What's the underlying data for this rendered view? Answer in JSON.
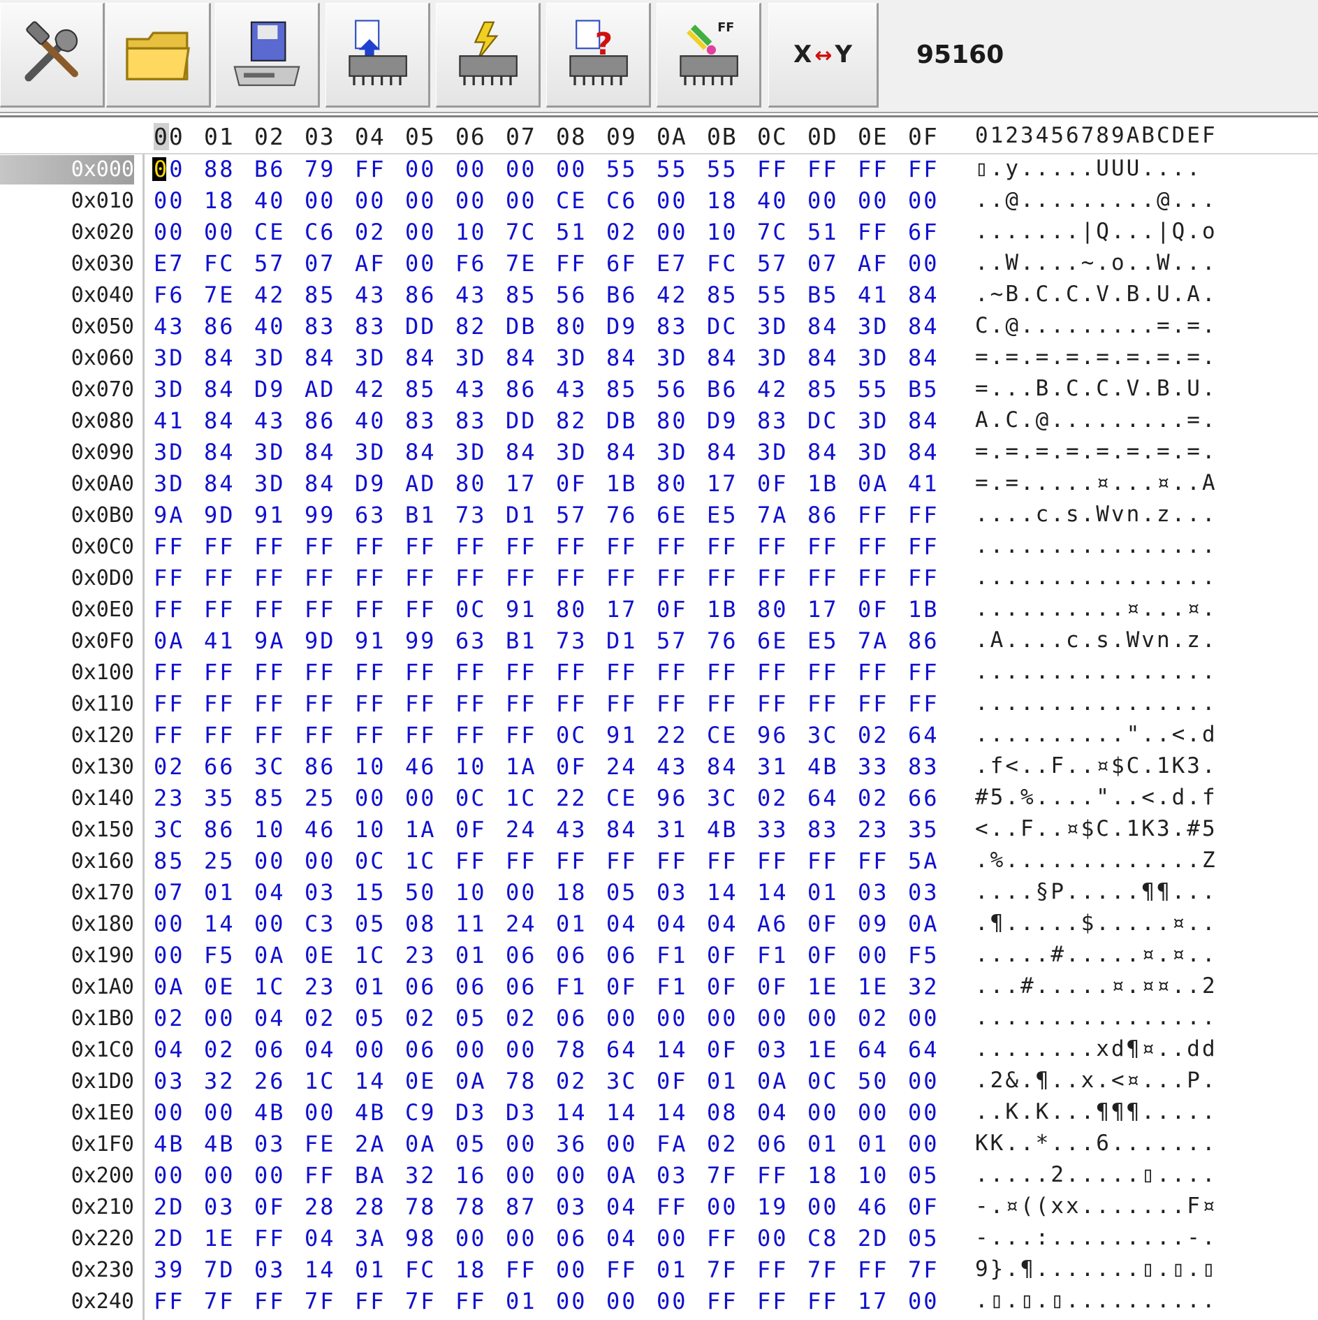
{
  "toolbar": {
    "buttons": [
      {
        "name": "settings-tools-icon"
      },
      {
        "name": "open-folder-icon"
      },
      {
        "name": "save-to-disk-icon"
      },
      {
        "name": "read-chip-icon"
      },
      {
        "name": "write-chip-icon"
      },
      {
        "name": "verify-chip-icon"
      },
      {
        "name": "erase-chip-icon"
      }
    ],
    "swap_x": "X",
    "swap_arrow": "↔",
    "swap_y": "Y",
    "counter": "95160"
  },
  "colors": {
    "hex_text": "#1010d0",
    "cursor_bg": "#000000",
    "cursor_fg": "#ffd800"
  },
  "header": {
    "columns": [
      "00",
      "01",
      "02",
      "03",
      "04",
      "05",
      "06",
      "07",
      "08",
      "09",
      "0A",
      "0B",
      "0C",
      "0D",
      "0E",
      "0F"
    ],
    "ascii_header": "0123456789ABCDEF"
  },
  "rows": [
    {
      "addr": "0x000",
      "bytes": [
        "00",
        "88",
        "B6",
        "79",
        "FF",
        "00",
        "00",
        "00",
        "00",
        "55",
        "55",
        "55",
        "FF",
        "FF",
        "FF",
        "FF"
      ],
      "ascii": "▯.y.....UUU...."
    },
    {
      "addr": "0x010",
      "bytes": [
        "00",
        "18",
        "40",
        "00",
        "00",
        "00",
        "00",
        "00",
        "CE",
        "C6",
        "00",
        "18",
        "40",
        "00",
        "00",
        "00"
      ],
      "ascii": "..@.........@..."
    },
    {
      "addr": "0x020",
      "bytes": [
        "00",
        "00",
        "CE",
        "C6",
        "02",
        "00",
        "10",
        "7C",
        "51",
        "02",
        "00",
        "10",
        "7C",
        "51",
        "FF",
        "6F"
      ],
      "ascii": ".......|Q...|Q.o"
    },
    {
      "addr": "0x030",
      "bytes": [
        "E7",
        "FC",
        "57",
        "07",
        "AF",
        "00",
        "F6",
        "7E",
        "FF",
        "6F",
        "E7",
        "FC",
        "57",
        "07",
        "AF",
        "00"
      ],
      "ascii": "..W....~.o..W..."
    },
    {
      "addr": "0x040",
      "bytes": [
        "F6",
        "7E",
        "42",
        "85",
        "43",
        "86",
        "43",
        "85",
        "56",
        "B6",
        "42",
        "85",
        "55",
        "B5",
        "41",
        "84"
      ],
      "ascii": ".~B.C.C.V.B.U.A."
    },
    {
      "addr": "0x050",
      "bytes": [
        "43",
        "86",
        "40",
        "83",
        "83",
        "DD",
        "82",
        "DB",
        "80",
        "D9",
        "83",
        "DC",
        "3D",
        "84",
        "3D",
        "84"
      ],
      "ascii": "C.@.........=.=."
    },
    {
      "addr": "0x060",
      "bytes": [
        "3D",
        "84",
        "3D",
        "84",
        "3D",
        "84",
        "3D",
        "84",
        "3D",
        "84",
        "3D",
        "84",
        "3D",
        "84",
        "3D",
        "84"
      ],
      "ascii": "=.=.=.=.=.=.=.=."
    },
    {
      "addr": "0x070",
      "bytes": [
        "3D",
        "84",
        "D9",
        "AD",
        "42",
        "85",
        "43",
        "86",
        "43",
        "85",
        "56",
        "B6",
        "42",
        "85",
        "55",
        "B5"
      ],
      "ascii": "=...B.C.C.V.B.U."
    },
    {
      "addr": "0x080",
      "bytes": [
        "41",
        "84",
        "43",
        "86",
        "40",
        "83",
        "83",
        "DD",
        "82",
        "DB",
        "80",
        "D9",
        "83",
        "DC",
        "3D",
        "84"
      ],
      "ascii": "A.C.@.........=."
    },
    {
      "addr": "0x090",
      "bytes": [
        "3D",
        "84",
        "3D",
        "84",
        "3D",
        "84",
        "3D",
        "84",
        "3D",
        "84",
        "3D",
        "84",
        "3D",
        "84",
        "3D",
        "84"
      ],
      "ascii": "=.=.=.=.=.=.=.=."
    },
    {
      "addr": "0x0A0",
      "bytes": [
        "3D",
        "84",
        "3D",
        "84",
        "D9",
        "AD",
        "80",
        "17",
        "0F",
        "1B",
        "80",
        "17",
        "0F",
        "1B",
        "0A",
        "41"
      ],
      "ascii": "=.=.....¤...¤..A"
    },
    {
      "addr": "0x0B0",
      "bytes": [
        "9A",
        "9D",
        "91",
        "99",
        "63",
        "B1",
        "73",
        "D1",
        "57",
        "76",
        "6E",
        "E5",
        "7A",
        "86",
        "FF",
        "FF"
      ],
      "ascii": "....c.s.Wvn.z..."
    },
    {
      "addr": "0x0C0",
      "bytes": [
        "FF",
        "FF",
        "FF",
        "FF",
        "FF",
        "FF",
        "FF",
        "FF",
        "FF",
        "FF",
        "FF",
        "FF",
        "FF",
        "FF",
        "FF",
        "FF"
      ],
      "ascii": "................"
    },
    {
      "addr": "0x0D0",
      "bytes": [
        "FF",
        "FF",
        "FF",
        "FF",
        "FF",
        "FF",
        "FF",
        "FF",
        "FF",
        "FF",
        "FF",
        "FF",
        "FF",
        "FF",
        "FF",
        "FF"
      ],
      "ascii": "................"
    },
    {
      "addr": "0x0E0",
      "bytes": [
        "FF",
        "FF",
        "FF",
        "FF",
        "FF",
        "FF",
        "0C",
        "91",
        "80",
        "17",
        "0F",
        "1B",
        "80",
        "17",
        "0F",
        "1B"
      ],
      "ascii": "..........¤...¤."
    },
    {
      "addr": "0x0F0",
      "bytes": [
        "0A",
        "41",
        "9A",
        "9D",
        "91",
        "99",
        "63",
        "B1",
        "73",
        "D1",
        "57",
        "76",
        "6E",
        "E5",
        "7A",
        "86"
      ],
      "ascii": ".A....c.s.Wvn.z."
    },
    {
      "addr": "0x100",
      "bytes": [
        "FF",
        "FF",
        "FF",
        "FF",
        "FF",
        "FF",
        "FF",
        "FF",
        "FF",
        "FF",
        "FF",
        "FF",
        "FF",
        "FF",
        "FF",
        "FF"
      ],
      "ascii": "................"
    },
    {
      "addr": "0x110",
      "bytes": [
        "FF",
        "FF",
        "FF",
        "FF",
        "FF",
        "FF",
        "FF",
        "FF",
        "FF",
        "FF",
        "FF",
        "FF",
        "FF",
        "FF",
        "FF",
        "FF"
      ],
      "ascii": "................"
    },
    {
      "addr": "0x120",
      "bytes": [
        "FF",
        "FF",
        "FF",
        "FF",
        "FF",
        "FF",
        "FF",
        "FF",
        "0C",
        "91",
        "22",
        "CE",
        "96",
        "3C",
        "02",
        "64"
      ],
      "ascii": "..........\"..<.d"
    },
    {
      "addr": "0x130",
      "bytes": [
        "02",
        "66",
        "3C",
        "86",
        "10",
        "46",
        "10",
        "1A",
        "0F",
        "24",
        "43",
        "84",
        "31",
        "4B",
        "33",
        "83"
      ],
      "ascii": ".f<..F..¤$C.1K3."
    },
    {
      "addr": "0x140",
      "bytes": [
        "23",
        "35",
        "85",
        "25",
        "00",
        "00",
        "0C",
        "1C",
        "22",
        "CE",
        "96",
        "3C",
        "02",
        "64",
        "02",
        "66"
      ],
      "ascii": "#5.%....\"..<.d.f"
    },
    {
      "addr": "0x150",
      "bytes": [
        "3C",
        "86",
        "10",
        "46",
        "10",
        "1A",
        "0F",
        "24",
        "43",
        "84",
        "31",
        "4B",
        "33",
        "83",
        "23",
        "35"
      ],
      "ascii": "<..F..¤$C.1K3.#5"
    },
    {
      "addr": "0x160",
      "bytes": [
        "85",
        "25",
        "00",
        "00",
        "0C",
        "1C",
        "FF",
        "FF",
        "FF",
        "FF",
        "FF",
        "FF",
        "FF",
        "FF",
        "FF",
        "5A"
      ],
      "ascii": ".%.............Z"
    },
    {
      "addr": "0x170",
      "bytes": [
        "07",
        "01",
        "04",
        "03",
        "15",
        "50",
        "10",
        "00",
        "18",
        "05",
        "03",
        "14",
        "14",
        "01",
        "03",
        "03"
      ],
      "ascii": "....§P.....¶¶..."
    },
    {
      "addr": "0x180",
      "bytes": [
        "00",
        "14",
        "00",
        "C3",
        "05",
        "08",
        "11",
        "24",
        "01",
        "04",
        "04",
        "04",
        "A6",
        "0F",
        "09",
        "0A"
      ],
      "ascii": ".¶.....$.....¤.."
    },
    {
      "addr": "0x190",
      "bytes": [
        "00",
        "F5",
        "0A",
        "0E",
        "1C",
        "23",
        "01",
        "06",
        "06",
        "06",
        "F1",
        "0F",
        "F1",
        "0F",
        "00",
        "F5"
      ],
      "ascii": ".....#.....¤.¤.."
    },
    {
      "addr": "0x1A0",
      "bytes": [
        "0A",
        "0E",
        "1C",
        "23",
        "01",
        "06",
        "06",
        "06",
        "F1",
        "0F",
        "F1",
        "0F",
        "0F",
        "1E",
        "1E",
        "32"
      ],
      "ascii": "...#.....¤.¤¤..2"
    },
    {
      "addr": "0x1B0",
      "bytes": [
        "02",
        "00",
        "04",
        "02",
        "05",
        "02",
        "05",
        "02",
        "06",
        "00",
        "00",
        "00",
        "00",
        "00",
        "02",
        "00"
      ],
      "ascii": "................"
    },
    {
      "addr": "0x1C0",
      "bytes": [
        "04",
        "02",
        "06",
        "04",
        "00",
        "06",
        "00",
        "00",
        "78",
        "64",
        "14",
        "0F",
        "03",
        "1E",
        "64",
        "64"
      ],
      "ascii": "........xd¶¤..dd"
    },
    {
      "addr": "0x1D0",
      "bytes": [
        "03",
        "32",
        "26",
        "1C",
        "14",
        "0E",
        "0A",
        "78",
        "02",
        "3C",
        "0F",
        "01",
        "0A",
        "0C",
        "50",
        "00"
      ],
      "ascii": ".2&.¶..x.<¤...P."
    },
    {
      "addr": "0x1E0",
      "bytes": [
        "00",
        "00",
        "4B",
        "00",
        "4B",
        "C9",
        "D3",
        "D3",
        "14",
        "14",
        "14",
        "08",
        "04",
        "00",
        "00",
        "00"
      ],
      "ascii": "..K.K...¶¶¶....."
    },
    {
      "addr": "0x1F0",
      "bytes": [
        "4B",
        "4B",
        "03",
        "FE",
        "2A",
        "0A",
        "05",
        "00",
        "36",
        "00",
        "FA",
        "02",
        "06",
        "01",
        "01",
        "00"
      ],
      "ascii": "KK..*...6......."
    },
    {
      "addr": "0x200",
      "bytes": [
        "00",
        "00",
        "00",
        "FF",
        "BA",
        "32",
        "16",
        "00",
        "00",
        "0A",
        "03",
        "7F",
        "FF",
        "18",
        "10",
        "05"
      ],
      "ascii": ".....2.....▯...."
    },
    {
      "addr": "0x210",
      "bytes": [
        "2D",
        "03",
        "0F",
        "28",
        "28",
        "78",
        "78",
        "87",
        "03",
        "04",
        "FF",
        "00",
        "19",
        "00",
        "46",
        "0F"
      ],
      "ascii": "-.¤((xx.......F¤"
    },
    {
      "addr": "0x220",
      "bytes": [
        "2D",
        "1E",
        "FF",
        "04",
        "3A",
        "98",
        "00",
        "00",
        "06",
        "04",
        "00",
        "FF",
        "00",
        "C8",
        "2D",
        "05"
      ],
      "ascii": "-...:.........-."
    },
    {
      "addr": "0x230",
      "bytes": [
        "39",
        "7D",
        "03",
        "14",
        "01",
        "FC",
        "18",
        "FF",
        "00",
        "FF",
        "01",
        "7F",
        "FF",
        "7F",
        "FF",
        "7F"
      ],
      "ascii": "9}.¶.......▯.▯.▯"
    },
    {
      "addr": "0x240",
      "bytes": [
        "FF",
        "7F",
        "FF",
        "7F",
        "FF",
        "7F",
        "FF",
        "01",
        "00",
        "00",
        "00",
        "FF",
        "FF",
        "FF",
        "17",
        "00"
      ],
      "ascii": ".▯.▯.▯.........."
    }
  ]
}
